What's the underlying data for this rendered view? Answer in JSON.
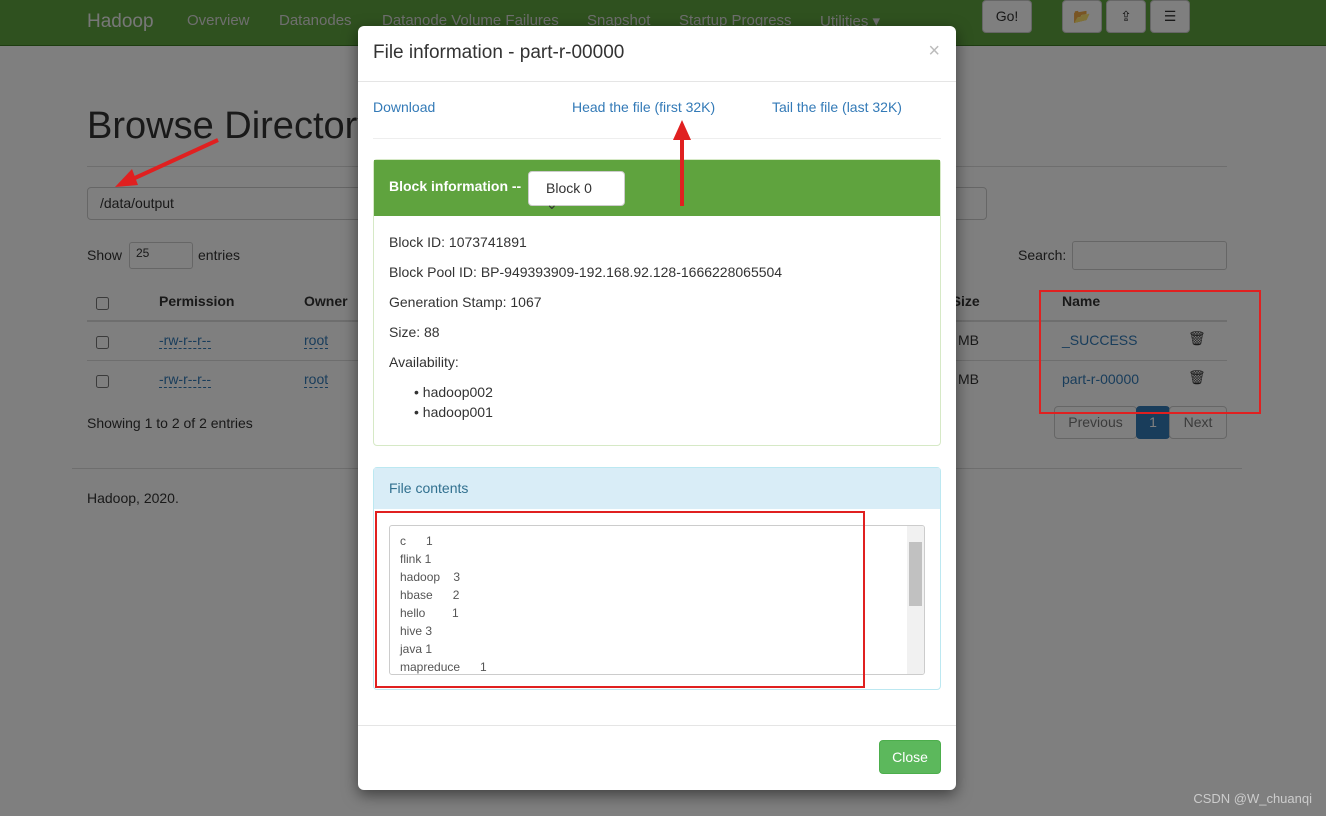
{
  "nav": {
    "brand": "Hadoop",
    "items": [
      "Overview",
      "Datanodes",
      "Datanode Volume Failures",
      "Snapshot",
      "Startup Progress",
      "Utilities ▾"
    ]
  },
  "page": {
    "title": "Browse Directory",
    "path": "/data/output",
    "go": "Go!",
    "show": "Show",
    "entries_value": "25",
    "entries": "entries",
    "search_label": "Search:",
    "columns": [
      "Permission",
      "Owner",
      "k Size",
      "Name"
    ],
    "rows": [
      {
        "permission": "-rw-r--r--",
        "owner": "root",
        "size": "MB",
        "name": "_SUCCESS"
      },
      {
        "permission": "-rw-r--r--",
        "owner": "root",
        "size": "MB",
        "name": "part-r-00000"
      }
    ],
    "showing": "Showing 1 to 2 of 2 entries",
    "pagination": {
      "previous": "Previous",
      "current": "1",
      "next": "Next"
    },
    "footer": "Hadoop, 2020."
  },
  "modal": {
    "title": "File information - part-r-00000",
    "close_x": "×",
    "download": "Download",
    "head": "Head the file (first 32K)",
    "tail": "Tail the file (last 32K)",
    "block_info_label": "Block information --",
    "block_select": "Block 0 ⌄",
    "block_id": "Block ID: 1073741891",
    "block_pool": "Block Pool ID: BP-949393909-192.168.92.128-1666228065504",
    "generation": "Generation Stamp: 1067",
    "size": "Size: 88",
    "availability": "Availability:",
    "hosts": [
      "hadoop002",
      "hadoop001"
    ],
    "file_contents_label": "File contents",
    "contents": [
      "c      1",
      "flink 1",
      "hadoop    3",
      "hbase      2",
      "hello        1",
      "hive 3",
      "java 1",
      "mapreduce      1"
    ],
    "close": "Close"
  },
  "watermark": "CSDN @W_chuanqi",
  "annotation_color": "#e02020"
}
